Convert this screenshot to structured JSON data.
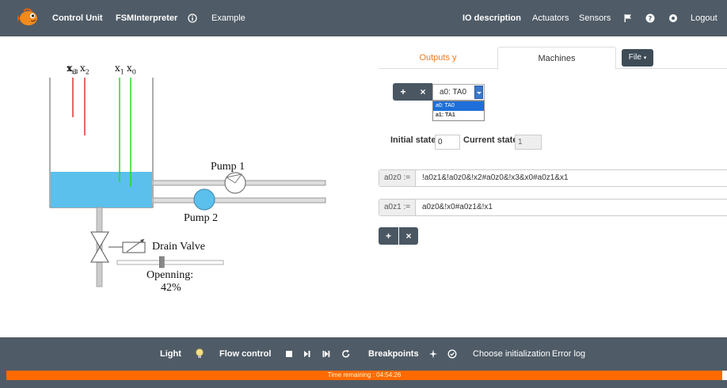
{
  "nav": {
    "brand_left": "Control Unit",
    "fsm": "FSMInterpreter",
    "example": "Example",
    "io_description": "IO description",
    "actuators": "Actuators",
    "sensors": "Sensors",
    "logout": "Logout",
    "icons": [
      "flag-icon",
      "help-icon",
      "settings-icon"
    ]
  },
  "plant": {
    "sensor_labels": [
      "x3",
      "x2",
      "x1",
      "x0"
    ],
    "pump1": "Pump 1",
    "pump2": "Pump 2",
    "drain_valve": "Drain Valve",
    "opening_label": "Openning:",
    "opening_value": "42%",
    "opening_fraction": 0.42,
    "colors": {
      "water": "#5bc0eb",
      "sensor_active": "#22dd22",
      "sensor_inactive": "#dd3333",
      "pipe": "#aaaaaa"
    }
  },
  "tabs": {
    "outputs": "Outputs y",
    "machines": "Machines",
    "file": "File"
  },
  "machine": {
    "add": "+",
    "remove": "×",
    "selected": "a0: TA0",
    "options": [
      "a0: TA0",
      "a1: TA1"
    ]
  },
  "state": {
    "initial_label": "Initial state",
    "initial_value": "0",
    "current_label": "Current state",
    "current_value": "1"
  },
  "equations": [
    {
      "label": "a0z0  :=",
      "value": "!a0z1&!a0z0&!x2#a0z0&!x3&x0#a0z1&x1"
    },
    {
      "label": "a0z1  :=",
      "value": "a0z0&!x0#a0z1&!x1"
    }
  ],
  "eq_buttons": {
    "add": "+",
    "remove": "×"
  },
  "footer": {
    "light": "Light",
    "flow_control": "Flow control",
    "breakpoints": "Breakpoints",
    "choose_init": "Choose initialization",
    "error_log": "Error log",
    "time_remaining": "Time remaining : 04:54:26",
    "accent": "#ff6a00"
  }
}
